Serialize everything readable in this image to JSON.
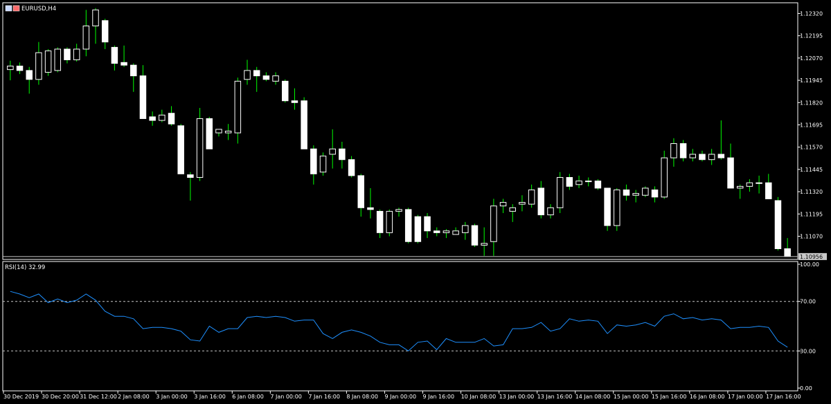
{
  "header": {
    "symbol_label": "EURUSD,H4"
  },
  "indicator": {
    "label": "RSI(14) 32.99"
  },
  "colors": {
    "background": "#000000",
    "bull_fill": "#000000",
    "bear_fill": "#ffffff",
    "candle_outline": "#ffffff",
    "wick": "#00ff00",
    "rsi_line": "#1e90ff",
    "grid": "#c8c8c8"
  },
  "chart_data": [
    {
      "type": "candlestick",
      "symbol": "EURUSD",
      "timeframe": "H4",
      "ylim": [
        1.1094,
        1.1238
      ],
      "y_ticks": [
        "1.12320",
        "1.12195",
        "1.12070",
        "1.11945",
        "1.11820",
        "1.11695",
        "1.11570",
        "1.11445",
        "1.11320",
        "1.11195",
        "1.11070"
      ],
      "current_price": "1.10956",
      "x_ticks": [
        "30 Dec 2019",
        "30 Dec 20:00",
        "31 Dec 12:00",
        "2 Jan 08:00",
        "3 Jan 00:00",
        "3 Jan 16:00",
        "6 Jan 08:00",
        "7 Jan 00:00",
        "7 Jan 16:00",
        "8 Jan 08:00",
        "9 Jan 00:00",
        "9 Jan 16:00",
        "10 Jan 08:00",
        "13 Jan 00:00",
        "13 Jan 16:00",
        "14 Jan 08:00",
        "15 Jan 00:00",
        "15 Jan 16:00",
        "16 Jan 08:00",
        "17 Jan 00:00",
        "17 Jan 16:00"
      ],
      "candles": [
        {
          "o": 1.12005,
          "h": 1.12055,
          "l": 1.11945,
          "c": 1.12025
        },
        {
          "o": 1.12025,
          "h": 1.12045,
          "l": 1.1198,
          "c": 1.12
        },
        {
          "o": 1.12,
          "h": 1.1202,
          "l": 1.1187,
          "c": 1.1195
        },
        {
          "o": 1.1195,
          "h": 1.1216,
          "l": 1.1192,
          "c": 1.121
        },
        {
          "o": 1.1199,
          "h": 1.1212,
          "l": 1.1197,
          "c": 1.1211
        },
        {
          "o": 1.12,
          "h": 1.1213,
          "l": 1.1199,
          "c": 1.1212
        },
        {
          "o": 1.1212,
          "h": 1.1213,
          "l": 1.1204,
          "c": 1.1206
        },
        {
          "o": 1.1206,
          "h": 1.1215,
          "l": 1.1205,
          "c": 1.1212
        },
        {
          "o": 1.1212,
          "h": 1.1234,
          "l": 1.1208,
          "c": 1.1225
        },
        {
          "o": 1.1225,
          "h": 1.1235,
          "l": 1.1215,
          "c": 1.1234
        },
        {
          "o": 1.1228,
          "h": 1.1229,
          "l": 1.1212,
          "c": 1.1216
        },
        {
          "o": 1.1213,
          "h": 1.1214,
          "l": 1.12,
          "c": 1.1204
        },
        {
          "o": 1.12045,
          "h": 1.1214,
          "l": 1.1202,
          "c": 1.1203
        },
        {
          "o": 1.1203,
          "h": 1.1204,
          "l": 1.1188,
          "c": 1.1197
        },
        {
          "o": 1.1197,
          "h": 1.1203,
          "l": 1.1175,
          "c": 1.1173
        },
        {
          "o": 1.1174,
          "h": 1.1177,
          "l": 1.1169,
          "c": 1.1172
        },
        {
          "o": 1.1172,
          "h": 1.1178,
          "l": 1.1171,
          "c": 1.1175
        },
        {
          "o": 1.1176,
          "h": 1.118,
          "l": 1.1169,
          "c": 1.117
        },
        {
          "o": 1.1169,
          "h": 1.117,
          "l": 1.1142,
          "c": 1.1142
        },
        {
          "o": 1.11415,
          "h": 1.1143,
          "l": 1.1127,
          "c": 1.114
        },
        {
          "o": 1.114,
          "h": 1.1179,
          "l": 1.1138,
          "c": 1.1173
        },
        {
          "o": 1.1173,
          "h": 1.1174,
          "l": 1.1158,
          "c": 1.1156
        },
        {
          "o": 1.1165,
          "h": 1.1167,
          "l": 1.1163,
          "c": 1.1167
        },
        {
          "o": 1.1165,
          "h": 1.117,
          "l": 1.1161,
          "c": 1.1166
        },
        {
          "o": 1.1165,
          "h": 1.1196,
          "l": 1.1159,
          "c": 1.1194
        },
        {
          "o": 1.1195,
          "h": 1.1206,
          "l": 1.1192,
          "c": 1.12
        },
        {
          "o": 1.12,
          "h": 1.1202,
          "l": 1.1188,
          "c": 1.1197
        },
        {
          "o": 1.1197,
          "h": 1.1199,
          "l": 1.1194,
          "c": 1.1195
        },
        {
          "o": 1.1194,
          "h": 1.1199,
          "l": 1.1192,
          "c": 1.1197
        },
        {
          "o": 1.1194,
          "h": 1.1195,
          "l": 1.1182,
          "c": 1.1183
        },
        {
          "o": 1.1183,
          "h": 1.119,
          "l": 1.1178,
          "c": 1.1182
        },
        {
          "o": 1.1183,
          "h": 1.1185,
          "l": 1.1156,
          "c": 1.1156
        },
        {
          "o": 1.1156,
          "h": 1.1158,
          "l": 1.1136,
          "c": 1.1142
        },
        {
          "o": 1.1143,
          "h": 1.1154,
          "l": 1.1141,
          "c": 1.1152
        },
        {
          "o": 1.1153,
          "h": 1.1167,
          "l": 1.1145,
          "c": 1.1156
        },
        {
          "o": 1.1156,
          "h": 1.116,
          "l": 1.1145,
          "c": 1.115
        },
        {
          "o": 1.115,
          "h": 1.1152,
          "l": 1.114,
          "c": 1.1141
        },
        {
          "o": 1.1141,
          "h": 1.1142,
          "l": 1.1118,
          "c": 1.1123
        },
        {
          "o": 1.1123,
          "h": 1.1134,
          "l": 1.1117,
          "c": 1.1122
        },
        {
          "o": 1.1121,
          "h": 1.1122,
          "l": 1.1106,
          "c": 1.1109
        },
        {
          "o": 1.1109,
          "h": 1.1122,
          "l": 1.1107,
          "c": 1.1121
        },
        {
          "o": 1.1121,
          "h": 1.1123,
          "l": 1.1118,
          "c": 1.1122
        },
        {
          "o": 1.1122,
          "h": 1.1123,
          "l": 1.1103,
          "c": 1.1104
        },
        {
          "o": 1.1118,
          "h": 1.1119,
          "l": 1.1103,
          "c": 1.1104
        },
        {
          "o": 1.1118,
          "h": 1.112,
          "l": 1.1106,
          "c": 1.111
        },
        {
          "o": 1.111,
          "h": 1.1112,
          "l": 1.1107,
          "c": 1.1109
        },
        {
          "o": 1.1109,
          "h": 1.1111,
          "l": 1.1106,
          "c": 1.111
        },
        {
          "o": 1.1108,
          "h": 1.1112,
          "l": 1.1108,
          "c": 1.111
        },
        {
          "o": 1.1109,
          "h": 1.1115,
          "l": 1.1105,
          "c": 1.1113
        },
        {
          "o": 1.1113,
          "h": 1.1114,
          "l": 1.1101,
          "c": 1.1102
        },
        {
          "o": 1.1102,
          "h": 1.1112,
          "l": 1.1096,
          "c": 1.1103
        },
        {
          "o": 1.1104,
          "h": 1.1128,
          "l": 1.1096,
          "c": 1.1124
        },
        {
          "o": 1.1124,
          "h": 1.1128,
          "l": 1.112,
          "c": 1.1126
        },
        {
          "o": 1.1121,
          "h": 1.1125,
          "l": 1.1115,
          "c": 1.1123
        },
        {
          "o": 1.1125,
          "h": 1.113,
          "l": 1.1121,
          "c": 1.1126
        },
        {
          "o": 1.1125,
          "h": 1.1136,
          "l": 1.1123,
          "c": 1.1133
        },
        {
          "o": 1.1134,
          "h": 1.1138,
          "l": 1.1117,
          "c": 1.1119
        },
        {
          "o": 1.1119,
          "h": 1.1125,
          "l": 1.1117,
          "c": 1.1123
        },
        {
          "o": 1.1123,
          "h": 1.1143,
          "l": 1.112,
          "c": 1.114
        },
        {
          "o": 1.114,
          "h": 1.1142,
          "l": 1.1133,
          "c": 1.1135
        },
        {
          "o": 1.1136,
          "h": 1.1141,
          "l": 1.1134,
          "c": 1.1138
        },
        {
          "o": 1.1138,
          "h": 1.114,
          "l": 1.1135,
          "c": 1.1138
        },
        {
          "o": 1.1138,
          "h": 1.1139,
          "l": 1.1133,
          "c": 1.1134
        },
        {
          "o": 1.1134,
          "h": 1.1134,
          "l": 1.111,
          "c": 1.1113
        },
        {
          "o": 1.1113,
          "h": 1.1134,
          "l": 1.111,
          "c": 1.1133
        },
        {
          "o": 1.1133,
          "h": 1.1136,
          "l": 1.1127,
          "c": 1.113
        },
        {
          "o": 1.113,
          "h": 1.1133,
          "l": 1.1126,
          "c": 1.1131
        },
        {
          "o": 1.113,
          "h": 1.1135,
          "l": 1.1129,
          "c": 1.1134
        },
        {
          "o": 1.1133,
          "h": 1.1135,
          "l": 1.1126,
          "c": 1.1129
        },
        {
          "o": 1.1129,
          "h": 1.1155,
          "l": 1.1128,
          "c": 1.1151
        },
        {
          "o": 1.1151,
          "h": 1.1162,
          "l": 1.1146,
          "c": 1.1159
        },
        {
          "o": 1.1159,
          "h": 1.1161,
          "l": 1.1149,
          "c": 1.1151
        },
        {
          "o": 1.1151,
          "h": 1.1156,
          "l": 1.1149,
          "c": 1.1153
        },
        {
          "o": 1.1153,
          "h": 1.1155,
          "l": 1.1149,
          "c": 1.115
        },
        {
          "o": 1.115,
          "h": 1.1156,
          "l": 1.1147,
          "c": 1.1153
        },
        {
          "o": 1.1153,
          "h": 1.1172,
          "l": 1.115,
          "c": 1.1151
        },
        {
          "o": 1.1151,
          "h": 1.1159,
          "l": 1.1147,
          "c": 1.1134
        },
        {
          "o": 1.1134,
          "h": 1.1136,
          "l": 1.1128,
          "c": 1.1135
        },
        {
          "o": 1.1135,
          "h": 1.1139,
          "l": 1.1132,
          "c": 1.1137
        },
        {
          "o": 1.1137,
          "h": 1.1141,
          "l": 1.1131,
          "c": 1.1137
        },
        {
          "o": 1.1137,
          "h": 1.1142,
          "l": 1.1128,
          "c": 1.1128
        },
        {
          "o": 1.1127,
          "h": 1.1129,
          "l": 1.1099,
          "c": 1.11
        },
        {
          "o": 1.11,
          "h": 1.1106,
          "l": 1.1096,
          "c": 1.10956
        }
      ]
    },
    {
      "type": "line",
      "series": [
        {
          "name": "RSI(14)",
          "values": [
            78.1,
            76,
            73,
            76,
            69,
            72,
            69,
            71,
            76,
            71,
            62,
            58,
            58,
            56,
            48,
            49,
            49,
            48,
            46,
            39,
            38,
            50,
            45,
            48,
            48,
            57,
            58,
            57,
            58,
            57,
            54,
            55,
            55,
            44,
            40,
            45,
            47,
            45,
            42,
            37,
            35,
            35,
            30,
            37,
            38,
            31,
            40,
            37,
            37,
            37,
            40,
            34,
            35,
            48,
            48,
            49,
            53,
            46,
            48,
            56,
            54,
            55,
            54,
            44,
            51,
            50,
            51,
            53,
            50,
            58,
            60,
            56,
            57,
            55,
            56,
            55,
            48,
            49,
            49,
            50,
            49,
            38,
            32.99
          ]
        }
      ],
      "ylim": [
        0,
        100
      ],
      "y_ticks": [
        "100.00",
        "70.00",
        "30.00",
        "0.00"
      ],
      "levels": [
        70,
        30
      ]
    }
  ]
}
